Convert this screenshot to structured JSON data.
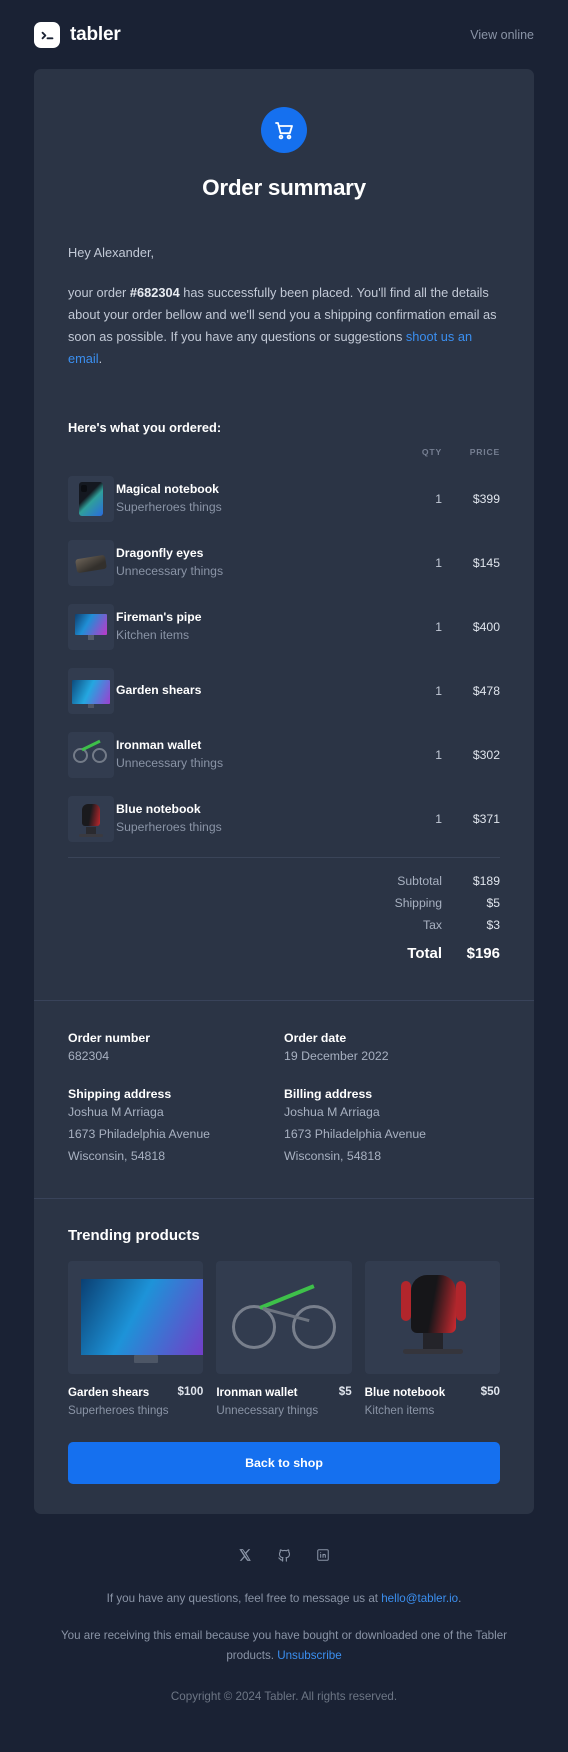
{
  "header": {
    "brand_name": "tabler",
    "brand_icon": "terminal-prompt-icon",
    "view_online_label": "View online"
  },
  "hero": {
    "icon": "shopping-cart-icon",
    "title": "Order summary"
  },
  "body": {
    "greeting": "Hey Alexander,",
    "intro_part1": "your order ",
    "order_ref": "#682304",
    "intro_part2": " has successfully been placed. You'll find all the details about your order bellow and we'll send you a shipping confirmation email as soon as possible. If you have any questions or suggestions ",
    "email_link": "shoot us an email",
    "intro_part3": ".",
    "ordered_label": "Here's what you ordered:"
  },
  "items_table": {
    "columns": [
      "",
      "",
      "QTY",
      "PRICE"
    ],
    "rows": [
      {
        "name": "Magical notebook",
        "category": "Superheroes things",
        "qty": "1",
        "price": "$399",
        "thumb": "phone-product-image"
      },
      {
        "name": "Dragonfly eyes",
        "category": "Unnecessary things",
        "qty": "1",
        "price": "$145",
        "thumb": "dark-device-product-image"
      },
      {
        "name": "Fireman's pipe",
        "category": "Kitchen items",
        "qty": "1",
        "price": "$400",
        "thumb": "monitor-product-image"
      },
      {
        "name": "Garden shears",
        "category": "",
        "qty": "1",
        "price": "$478",
        "thumb": "tv-product-image"
      },
      {
        "name": "Ironman wallet",
        "category": "Unnecessary things",
        "qty": "1",
        "price": "$302",
        "thumb": "bicycle-product-image"
      },
      {
        "name": "Blue notebook",
        "category": "Superheroes things",
        "qty": "1",
        "price": "$371",
        "thumb": "gaming-chair-product-image"
      }
    ]
  },
  "totals": {
    "subtotal_label": "Subtotal",
    "subtotal_value": "$189",
    "shipping_label": "Shipping",
    "shipping_value": "$5",
    "tax_label": "Tax",
    "tax_value": "$3",
    "total_label": "Total",
    "total_value": "$196"
  },
  "details": {
    "order_number_label": "Order number",
    "order_number_value": "682304",
    "order_date_label": "Order date",
    "order_date_value": "19 December 2022",
    "shipping_address_label": "Shipping address",
    "shipping_address_line1": "Joshua M Arriaga",
    "shipping_address_line2": "1673 Philadelphia Avenue",
    "shipping_address_line3": "Wisconsin, 54818",
    "billing_address_label": "Billing address",
    "billing_address_line1": "Joshua M Arriaga",
    "billing_address_line2": "1673 Philadelphia Avenue",
    "billing_address_line3": "Wisconsin, 54818"
  },
  "trending": {
    "title": "Trending products",
    "products": [
      {
        "name": "Garden shears",
        "price": "$100",
        "category": "Superheroes things",
        "image": "tv-product-image"
      },
      {
        "name": "Ironman wallet",
        "price": "$5",
        "category": "Unnecessary things",
        "image": "bicycle-product-image"
      },
      {
        "name": "Blue notebook",
        "price": "$50",
        "category": "Kitchen items",
        "image": "gaming-chair-product-image"
      }
    ],
    "cta_label": "Back to shop"
  },
  "footer": {
    "socials": [
      "x-twitter-icon",
      "github-icon",
      "linkedin-icon"
    ],
    "contact_prefix": "If you have any questions, feel free to message us at ",
    "contact_email": "hello@tabler.io",
    "contact_suffix": ".",
    "reason_prefix": "You are receiving this email because you have bought or downloaded one of the Tabler products. ",
    "unsubscribe_label": "Unsubscribe",
    "copyright": "Copyright © 2024 Tabler. All rights reserved."
  },
  "colors": {
    "page_bg": "#1a2234",
    "card_bg": "#2b3445",
    "accent": "#1570ef",
    "link": "#3b8ff0"
  }
}
